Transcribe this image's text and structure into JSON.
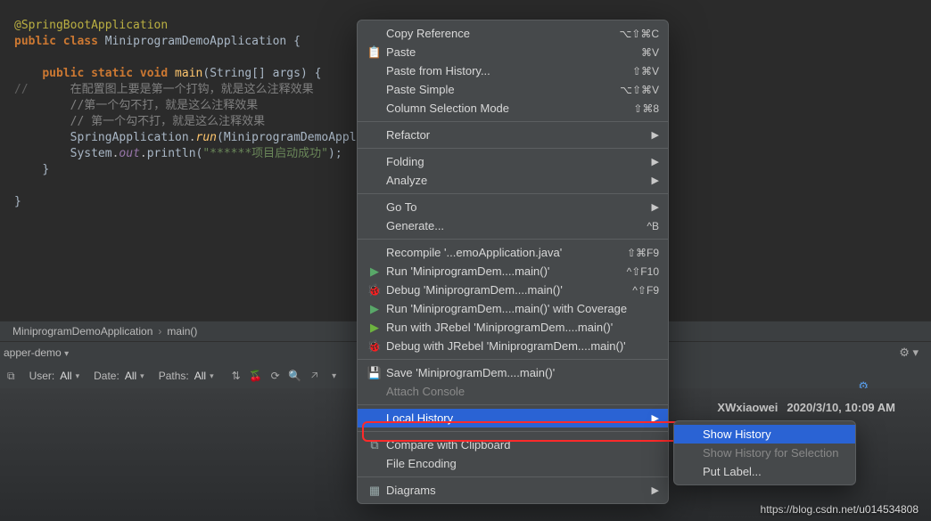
{
  "code": {
    "anno": "@SpringBootApplication",
    "cls_decl_pub": "public",
    "cls_decl_class": "class",
    "cls_name": "MiniprogramDemoApplication",
    "brace_open": "{",
    "m_pub": "public",
    "m_static": "static",
    "m_void": "void",
    "m_name": "main",
    "m_args_type": "String[]",
    "m_args_name": "args",
    "comment_marker": "//",
    "c1": "在配置图上要是第一个打钩，就是这么注释效果",
    "c2": "//第一个勾不打，就是这么注释效果",
    "c3": "// 第一个勾不打，就是这么注释效果",
    "call1_cls": "SpringApplication",
    "call1_m": "run",
    "call1_arg": "MiniprogramDemoAppl",
    "call2_cls": "System",
    "call2_field": "out",
    "call2_m": "println",
    "call2_str": "\"******项目启动成功\"",
    "brace_close": "}"
  },
  "breadcrumb": {
    "a": "MiniprogramDemoApplication",
    "b": "main()"
  },
  "vcs": {
    "branch": "apper-demo",
    "user_label": "User:",
    "user_val": "All",
    "date_label": "Date:",
    "date_val": "All",
    "paths_label": "Paths:",
    "paths_val": "All"
  },
  "commit": {
    "name1": "XWxiaowei",
    "date1": "2020/3/10, 10:09 AM"
  },
  "watermark": "https://blog.csdn.net/u014534808",
  "menu": {
    "copy_ref": "Copy Reference",
    "copy_ref_sc": "⌥⇧⌘C",
    "paste": "Paste",
    "paste_sc": "⌘V",
    "paste_hist": "Paste from History...",
    "paste_hist_sc": "⇧⌘V",
    "paste_simple": "Paste Simple",
    "paste_simple_sc": "⌥⇧⌘V",
    "col_sel": "Column Selection Mode",
    "col_sel_sc": "⇧⌘8",
    "refactor": "Refactor",
    "folding": "Folding",
    "analyze": "Analyze",
    "goto": "Go To",
    "generate": "Generate...",
    "generate_sc": "^B",
    "recompile": "Recompile '...emoApplication.java'",
    "recompile_sc": "⇧⌘F9",
    "run": "Run 'MiniprogramDem....main()'",
    "run_sc": "^⇧F10",
    "debug": "Debug 'MiniprogramDem....main()'",
    "debug_sc": "^⇧F9",
    "run_cov": "Run 'MiniprogramDem....main()' with Coverage",
    "run_jr": "Run with JRebel 'MiniprogramDem....main()'",
    "debug_jr": "Debug with JRebel 'MiniprogramDem....main()'",
    "save_main": "Save 'MiniprogramDem....main()'",
    "attach": "Attach Console",
    "local_history": "Local History",
    "compare": "Compare with Clipboard",
    "file_enc": "File Encoding",
    "diagrams": "Diagrams"
  },
  "submenu": {
    "show_hist": "Show History",
    "show_sel": "Show History for Selection",
    "put_label": "Put Label..."
  }
}
